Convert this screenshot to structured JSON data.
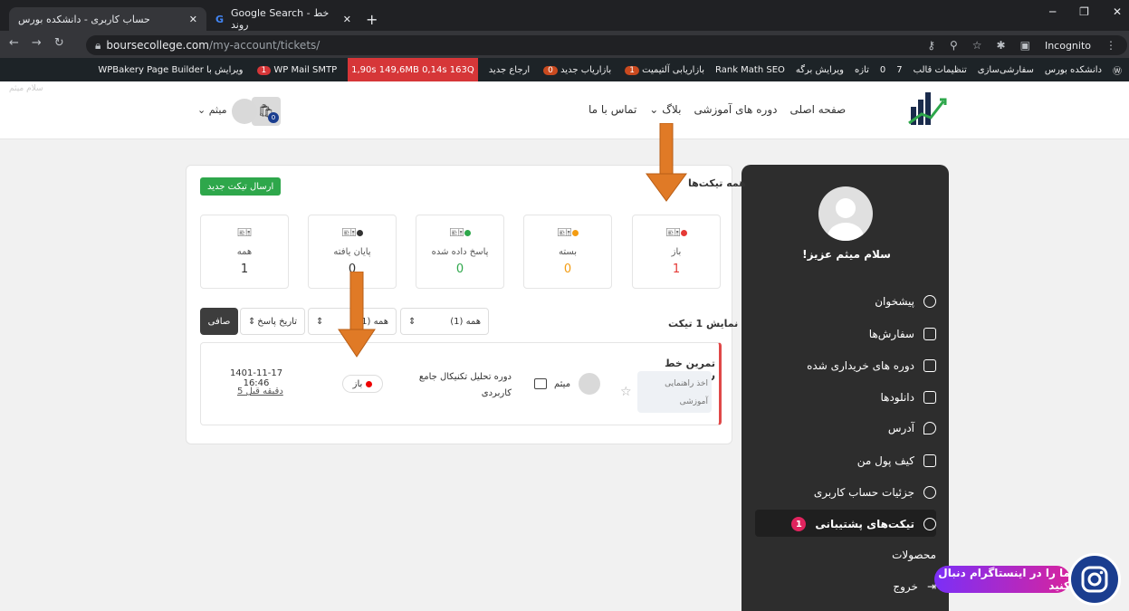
{
  "browser": {
    "tab1_title": "حساب کاربری - دانشکده بورس",
    "tab2_title": "Google Search - خط روند",
    "url_host": "boursecollege.com",
    "url_path": "/my-account/tickets/",
    "incognito": "Incognito"
  },
  "adminbar": {
    "items": [
      "دانشکده بورس",
      "سفارشی‌سازی",
      "تنظیمات قالب",
      "7",
      "0",
      "تازه",
      "ویرایش برگه",
      "Rank Math SEO",
      "بازاریابی آلتیمیت",
      "بازاریاب جدید",
      "ارجاع جدید"
    ],
    "badge1": "1",
    "badge2": "0",
    "perf": "1,90s 149,6MB 0,14s 163Q",
    "smtp": "WP Mail SMTP",
    "smtp_badge": "1",
    "wpbakery": "ویرایش با WPBakery Page Builder"
  },
  "header": {
    "nav": [
      "صفحه اصلی",
      "دوره های آموزشی",
      "بلاگ",
      "تماس با ما"
    ],
    "username": "میثم",
    "cart_count": "0",
    "gray_label": "سلام میثم"
  },
  "sidebar": {
    "greeting": "سلام میثم عزیز!",
    "items": [
      "پیشخوان",
      "سفارش‌ها",
      "دوره های خریداری شده",
      "دانلودها",
      "آدرس",
      "کیف پول من",
      "جزئیات حساب کاربری",
      "تیکت‌های پشتیبانی",
      "محصولات",
      "خروج"
    ],
    "ticket_badge": "1"
  },
  "panel": {
    "title": "همه تیکت‌ها",
    "new_ticket": "ارسال تیکت جدید",
    "stats": [
      {
        "label": "باز",
        "value": "1",
        "color": "#e53935"
      },
      {
        "label": "بسته",
        "value": "0",
        "color": "#f39c12"
      },
      {
        "label": "پاسخ داده شده",
        "value": "0",
        "color": "#2ea74b"
      },
      {
        "label": "پایان یافته",
        "value": "0",
        "color": "#333333"
      },
      {
        "label": "همه",
        "value": "1",
        "color": "#333333"
      }
    ],
    "show_count": "نمایش 1 تیکت",
    "filters": [
      "همه (1)",
      "همه (1)",
      "تاریخ پاسخ"
    ],
    "clear": "صافی"
  },
  "ticket": {
    "title": "تمرین خط روند",
    "category_1": "اخذ راهنمایی",
    "category_2": "آموزشی",
    "user": "میثم",
    "course": "دوره تحلیل تکنیکال جامع کاربردی",
    "status": "باز",
    "date": "1401-11-17 16:46",
    "ago": "5 دقیقه قبل"
  },
  "instagram": {
    "label": "ما را در اینستاگرام دنبال کنید"
  },
  "colors": {
    "accent_green": "#2ea74b",
    "open_red": "#e53935",
    "arrow_orange": "#e07a26",
    "sidebar_bg": "#2d2d2d"
  }
}
